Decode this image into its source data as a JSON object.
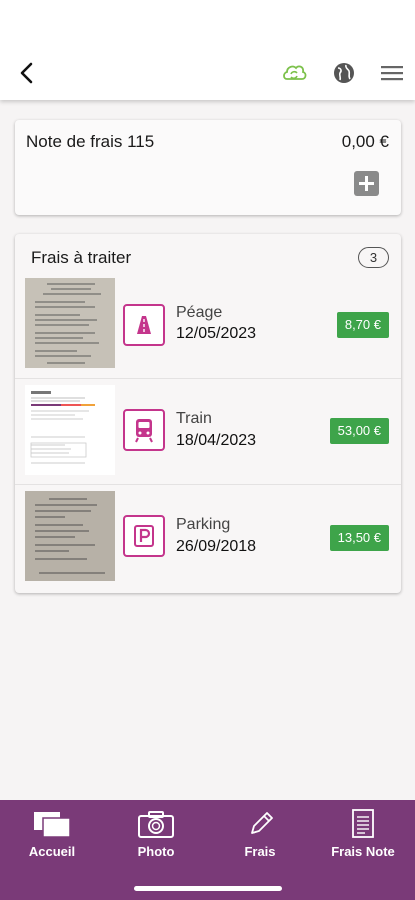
{
  "header": {
    "back_icon": "chevron-left-icon",
    "icons": [
      "cloud-sync-icon",
      "globe-icon",
      "hamburger-menu-icon"
    ],
    "accent_cloud": "#7cc14b"
  },
  "note": {
    "title": "Note de frais 115",
    "amount": "0,00 €"
  },
  "pending": {
    "title": "Frais à traiter",
    "count": "3",
    "items": [
      {
        "category": "Péage",
        "date": "12/05/2023",
        "amount": "8,70 €",
        "icon": "highway-icon"
      },
      {
        "category": "Train",
        "date": "18/04/2023",
        "amount": "53,00 €",
        "icon": "train-icon"
      },
      {
        "category": "Parking",
        "date": "26/09/2018",
        "amount": "13,50 €",
        "icon": "parking-icon"
      }
    ]
  },
  "nav": {
    "items": [
      {
        "label": "Accueil",
        "icon": "home-cards-icon"
      },
      {
        "label": "Photo",
        "icon": "camera-icon"
      },
      {
        "label": "Frais",
        "icon": "pencil-icon"
      },
      {
        "label": "Frais Note",
        "icon": "document-icon"
      }
    ]
  },
  "colors": {
    "brand_purple": "#7a3a78",
    "category_pink": "#c4358c",
    "amount_green": "#3ea44a"
  }
}
